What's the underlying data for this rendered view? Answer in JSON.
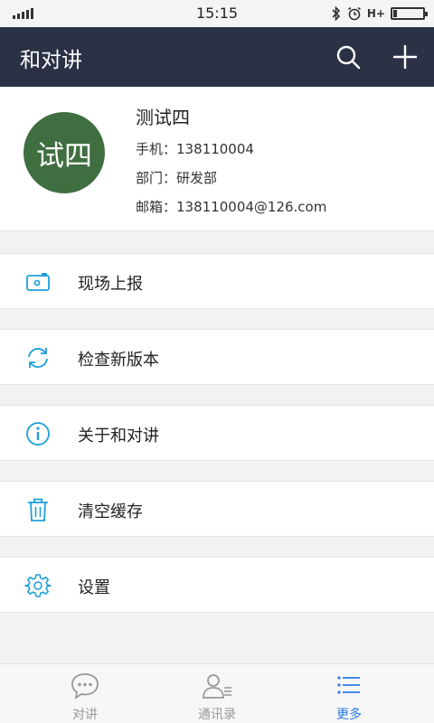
{
  "status_bar": {
    "time": "15:15",
    "network": "H+"
  },
  "header": {
    "title": "和对讲",
    "search_icon": "search-icon",
    "add_icon": "plus-icon"
  },
  "profile": {
    "avatar_text": "试四",
    "avatar_color": "#3f6e40",
    "name": "测试四",
    "phone_label": "手机：",
    "phone": "138110004",
    "dept_label": "部门：",
    "dept": "研发部",
    "email_label": "邮箱：",
    "email": "138110004@126.com"
  },
  "menu": [
    {
      "label": "现场上报",
      "icon": "camera-icon"
    },
    {
      "label": "检查新版本",
      "icon": "refresh-icon"
    },
    {
      "label": "关于和对讲",
      "icon": "info-icon"
    },
    {
      "label": "清空缓存",
      "icon": "trash-icon"
    },
    {
      "label": "设置",
      "icon": "gear-icon"
    }
  ],
  "bottom_nav": {
    "tabs": [
      {
        "label": "对讲",
        "icon": "chat-icon",
        "active": false
      },
      {
        "label": "通讯录",
        "icon": "contacts-icon",
        "active": false
      },
      {
        "label": "更多",
        "icon": "list-icon",
        "active": true
      }
    ],
    "active_color": "#2a7be4"
  },
  "colors": {
    "header_bg": "#2b3246",
    "accent": "#1ea0d8"
  }
}
